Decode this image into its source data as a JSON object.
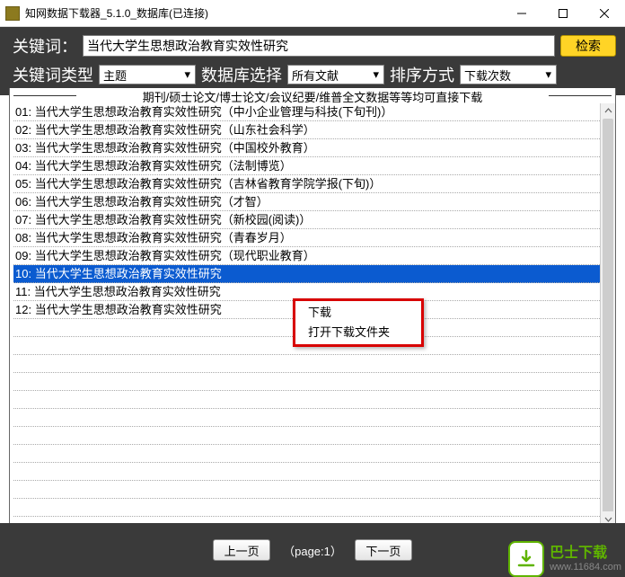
{
  "window": {
    "title": "知网数据下载器_5.1.0_数据库(已连接)"
  },
  "toolbar": {
    "keyword_label": "关键词：",
    "keyword_value": "当代大学生思想政治教育实效性研究",
    "search_label": "检索",
    "type_label": "关键词类型",
    "type_value": "主题",
    "db_label": "数据库选择",
    "db_value": "所有文献",
    "sort_label": "排序方式",
    "sort_value": "下载次数"
  },
  "legend": "期刊/硕士论文/博士论文/会议纪要/维普全文数据等等均可直接下载",
  "items": [
    {
      "idx": "01:",
      "text": "当代大学生思想政治教育实效性研究（中小企业管理与科技(下旬刊)）"
    },
    {
      "idx": "02:",
      "text": "当代大学生思想政治教育实效性研究（山东社会科学）"
    },
    {
      "idx": "03:",
      "text": "当代大学生思想政治教育实效性研究（中国校外教育）"
    },
    {
      "idx": "04:",
      "text": "当代大学生思想政治教育实效性研究（法制博览）"
    },
    {
      "idx": "05:",
      "text": "当代大学生思想政治教育实效性研究（吉林省教育学院学报(下旬)）"
    },
    {
      "idx": "06:",
      "text": "当代大学生思想政治教育实效性研究（才智）"
    },
    {
      "idx": "07:",
      "text": "当代大学生思想政治教育实效性研究（新校园(阅读)）"
    },
    {
      "idx": "08:",
      "text": "当代大学生思想政治教育实效性研究（青春岁月）"
    },
    {
      "idx": "09:",
      "text": "当代大学生思想政治教育实效性研究（现代职业教育）"
    },
    {
      "idx": "10:",
      "text": "当代大学生思想政治教育实效性研究"
    },
    {
      "idx": "11:",
      "text": "当代大学生思想政治教育实效性研究"
    },
    {
      "idx": "12:",
      "text": "当代大学生思想政治教育实效性研究"
    }
  ],
  "selected_index": 9,
  "context_menu": {
    "download": "下载",
    "open_folder": "打开下载文件夹"
  },
  "footer": {
    "prev": "上一页",
    "page": "（page:1）",
    "next": "下一页"
  },
  "watermark": {
    "cn": "巴士下载",
    "url": "www.11684.com"
  }
}
